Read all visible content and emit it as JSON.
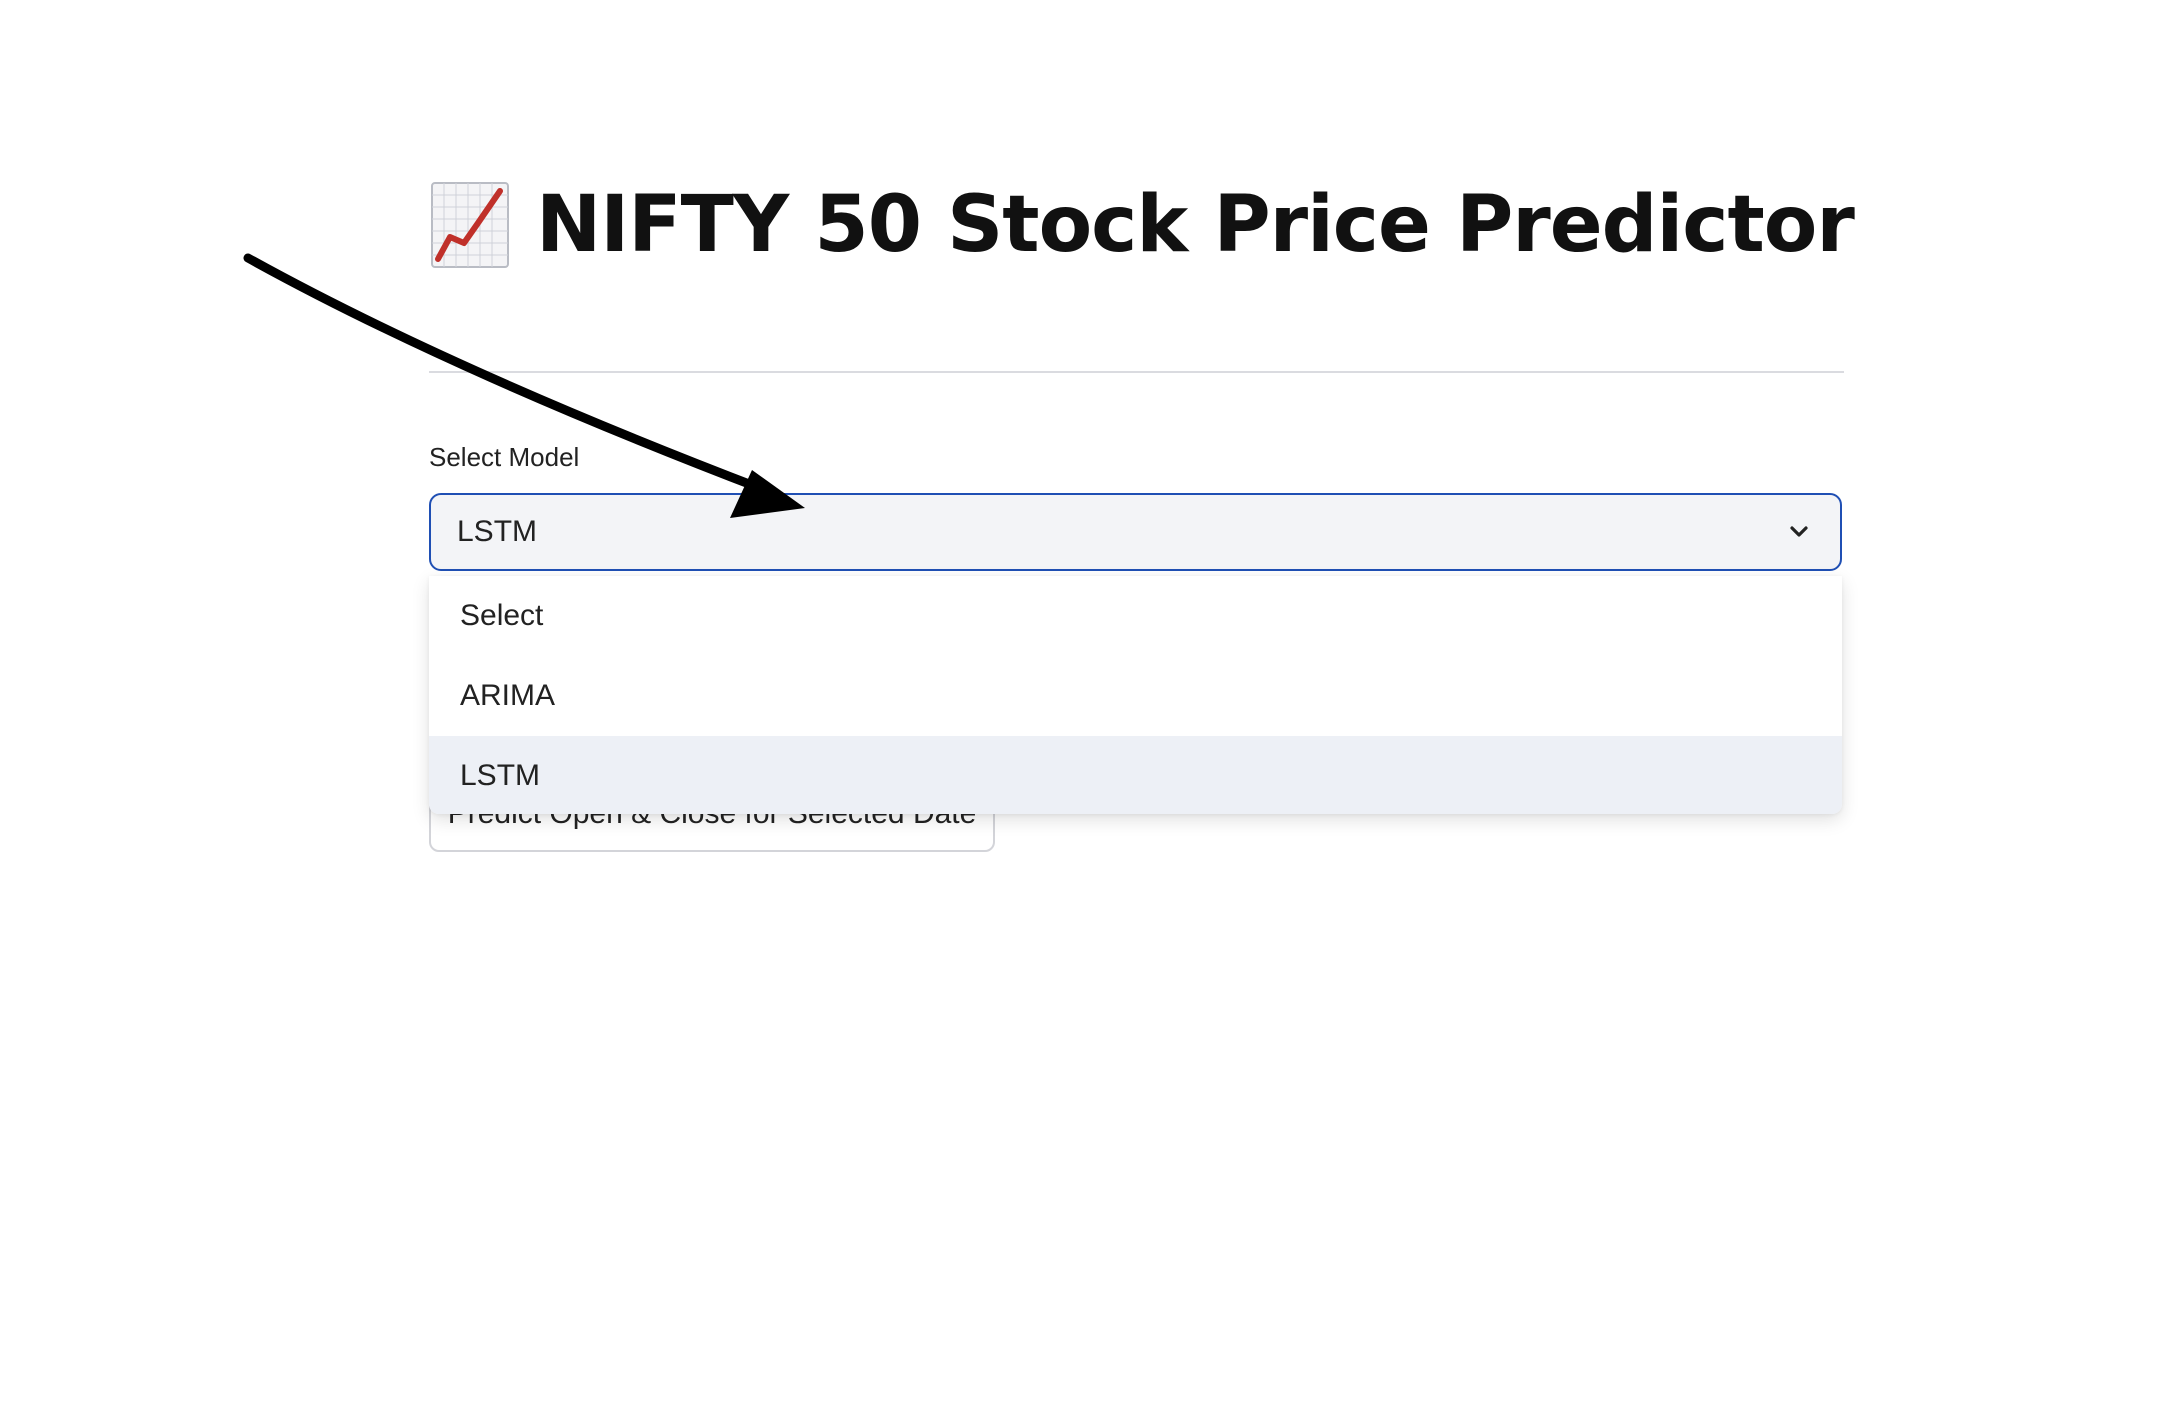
{
  "header": {
    "title": "NIFTY 50 Stock Price Predictor",
    "title_icon": "chart-increasing-emoji"
  },
  "model_select": {
    "label": "Select Model",
    "selected_value": "LSTM",
    "icon": "chevron-down-icon",
    "options": [
      {
        "label": "Select"
      },
      {
        "label": "ARIMA"
      },
      {
        "label": "LSTM",
        "highlighted": true
      }
    ]
  },
  "actions": {
    "predict_label": "Predict Open & Close for Selected Date"
  },
  "colors": {
    "focus_border": "#1f4fb4",
    "select_background": "#f3f4f7",
    "highlight_background": "#edf0f6",
    "arrow": "#000000"
  }
}
